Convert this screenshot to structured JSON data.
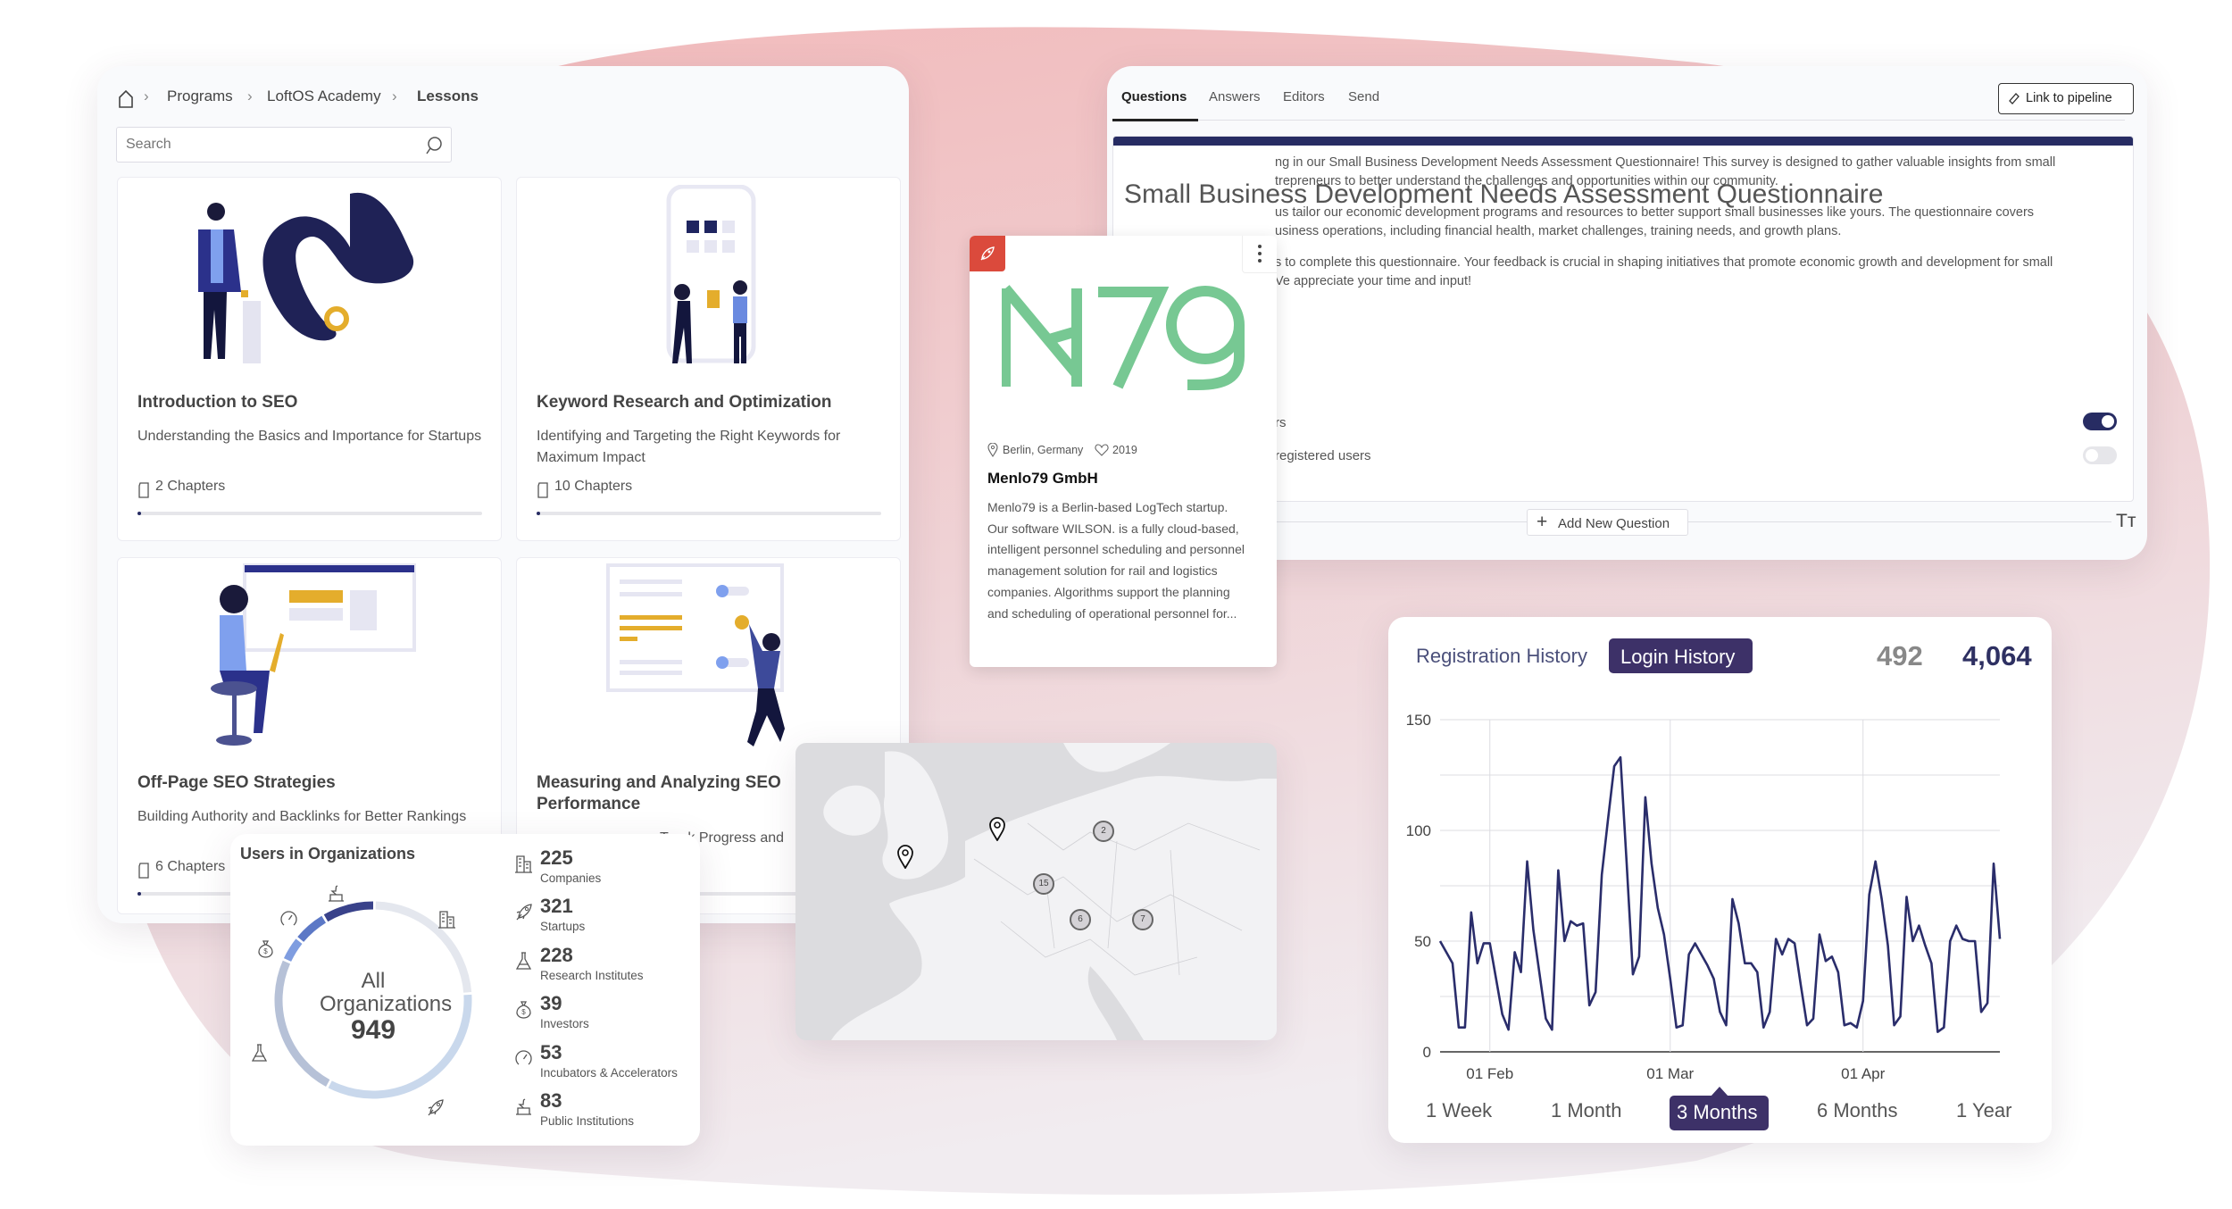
{
  "colors": {
    "navy": "#272c63",
    "accent_purple": "#3d3168",
    "logo_green": "#77c893",
    "badge_red": "#db4a3c",
    "map_gray": "#dcdcdf"
  },
  "lessons": {
    "breadcrumb": {
      "home_icon": "home-icon",
      "items": [
        "Programs",
        "LoftOS Academy",
        "Lessons"
      ]
    },
    "search": {
      "placeholder": "Search",
      "icon": "search-icon"
    },
    "cards": [
      {
        "title": "Introduction to SEO",
        "subtitle": "Understanding the Basics and Importance for Startups",
        "chapters": "2 Chapters",
        "progress": 0.01
      },
      {
        "title": "Keyword Research and Optimization",
        "subtitle": "Identifying and Targeting the Right Keywords for Maximum Impact",
        "chapters": "10 Chapters",
        "progress": 0.01
      },
      {
        "title": "Off-Page SEO Strategies",
        "subtitle": "Building Authority and Backlinks for Better Rankings",
        "chapters": "6 Chapters",
        "progress": 0.01
      },
      {
        "title": "Measuring and Analyzing SEO Performance",
        "subtitle": "Track Progress and",
        "chapters": "",
        "progress": 0.01
      }
    ]
  },
  "questionnaire": {
    "tabs": [
      "Questions",
      "Answers",
      "Editors",
      "Send"
    ],
    "active_tab": "Questions",
    "link_button": "Link to pipeline",
    "title": "Small Business Development Needs Assessment Questionnaire",
    "paragraphs": [
      [
        "ng in our Small Business Development Needs Assessment Questionnaire! This survey is designed to gather valuable insights from small",
        "trepreneurs to better understand the challenges and opportunities within our community."
      ],
      [
        "us tailor our economic development programs and resources to better support small businesses like yours. The questionnaire covers",
        "usiness operations, including financial health, market challenges, training needs, and growth plans."
      ],
      [
        "s to complete this questionnaire. Your feedback is crucial in shaping initiatives that promote economic growth and development for small",
        "Ve appreciate your time and input!"
      ]
    ],
    "toggles": [
      {
        "label": "rs",
        "on": true
      },
      {
        "label": "registered users",
        "on": false
      }
    ],
    "add_question": "Add New Question",
    "text_format_icon": "Tт"
  },
  "company": {
    "badge_icon": "rocket-icon",
    "logo_text": "M79",
    "location": "Berlin, Germany",
    "founded": "2019",
    "name": "Menlo79 GmbH",
    "description": [
      "Menlo79 is a Berlin-based LogTech startup.",
      "Our software WILSON. is a fully cloud-based,",
      "intelligent personnel scheduling and personnel",
      "management solution for rail and logistics",
      "companies. Algorithms support the planning",
      "and scheduling of operational personnel for..."
    ]
  },
  "map": {
    "pins": 2,
    "clusters": [
      "2",
      "15",
      "6",
      "7"
    ]
  },
  "orgs": {
    "title": "Users in Organizations",
    "center_label": "All Organizations",
    "total": "949",
    "segments": [
      {
        "label": "Companies",
        "value": 225,
        "icon": "building-icon",
        "color": "#e4e7ee"
      },
      {
        "label": "Startups",
        "value": 321,
        "icon": "rocket-icon",
        "color": "#c9d8ec"
      },
      {
        "label": "Research Institutes",
        "value": 228,
        "icon": "flask-icon",
        "color": "#b6c1d7"
      },
      {
        "label": "Investors",
        "value": 39,
        "icon": "money-bag-icon",
        "color": "#7f9de0"
      },
      {
        "label": "Incubators & Accelerators",
        "value": 53,
        "icon": "gauge-icon",
        "color": "#5c78c6"
      },
      {
        "label": "Public Institutions",
        "value": 83,
        "icon": "podium-icon",
        "color": "#39428a"
      }
    ]
  },
  "history": {
    "tabs": [
      "Registration History",
      "Login History"
    ],
    "active_tab": "Login History",
    "count_registration": "492",
    "count_login": "4,064",
    "ranges": [
      "1 Week",
      "1 Month",
      "3 Months",
      "6 Months",
      "1 Year"
    ],
    "active_range": "3 Months"
  },
  "chart_data": {
    "type": "line",
    "title": "",
    "xlabel": "",
    "ylabel": "",
    "ylim": [
      0,
      150
    ],
    "yticks": [
      0,
      50,
      100,
      150
    ],
    "xtick_labels": [
      "01 Feb",
      "01 Mar",
      "01 Apr"
    ],
    "grid": true,
    "line_color": "#2a2d6b",
    "x": [
      "Jan 24",
      "Jan 25",
      "Jan 26",
      "Jan 27",
      "Jan 28",
      "Jan 29",
      "Jan 30",
      "Jan 31",
      "Feb 1",
      "Feb 2",
      "Feb 3",
      "Feb 4",
      "Feb 5",
      "Feb 6",
      "Feb 7",
      "Feb 8",
      "Feb 9",
      "Feb 10",
      "Feb 11",
      "Feb 12",
      "Feb 13",
      "Feb 14",
      "Feb 15",
      "Feb 16",
      "Feb 17",
      "Feb 18",
      "Feb 19",
      "Feb 20",
      "Feb 21",
      "Feb 22",
      "Feb 23",
      "Feb 24",
      "Feb 25",
      "Feb 26",
      "Feb 27",
      "Feb 28",
      "Feb 29",
      "Mar 1",
      "Mar 2",
      "Mar 3",
      "Mar 4",
      "Mar 5",
      "Mar 6",
      "Mar 7",
      "Mar 8",
      "Mar 9",
      "Mar 10",
      "Mar 11",
      "Mar 12",
      "Mar 13",
      "Mar 14",
      "Mar 15",
      "Mar 16",
      "Mar 17",
      "Mar 18",
      "Mar 19",
      "Mar 20",
      "Mar 21",
      "Mar 22",
      "Mar 23",
      "Mar 24",
      "Mar 25",
      "Mar 26",
      "Mar 27",
      "Mar 28",
      "Mar 29",
      "Mar 30",
      "Mar 31",
      "Apr 1",
      "Apr 2",
      "Apr 3",
      "Apr 4",
      "Apr 5",
      "Apr 6",
      "Apr 7",
      "Apr 8",
      "Apr 9",
      "Apr 10",
      "Apr 11",
      "Apr 12",
      "Apr 13",
      "Apr 14",
      "Apr 15",
      "Apr 16",
      "Apr 17",
      "Apr 18",
      "Apr 19",
      "Apr 20",
      "Apr 21",
      "Apr 22",
      "Apr 23"
    ],
    "values": [
      50,
      45,
      40,
      11,
      11,
      63,
      40,
      49,
      49,
      33,
      17,
      10,
      45,
      36,
      86,
      55,
      35,
      15,
      10,
      82,
      50,
      59,
      57,
      58,
      21,
      27,
      80,
      105,
      129,
      133,
      85,
      35,
      43,
      115,
      85,
      65,
      53,
      33,
      11,
      12,
      44,
      49,
      44,
      39,
      33,
      18,
      12,
      69,
      58,
      40,
      40,
      36,
      11,
      18,
      51,
      44,
      51,
      49,
      30,
      12,
      15,
      53,
      41,
      43,
      36,
      12,
      13,
      11,
      23,
      71,
      86,
      69,
      48,
      12,
      16,
      70,
      50,
      57,
      48,
      40,
      9,
      11,
      50,
      57,
      51,
      50,
      50,
      18,
      22,
      85,
      51
    ]
  }
}
